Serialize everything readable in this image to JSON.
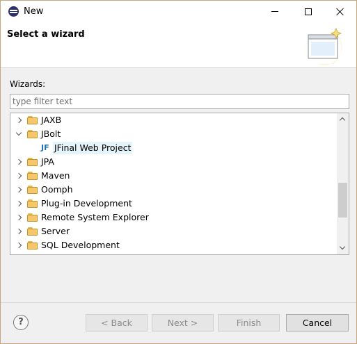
{
  "window": {
    "title": "New"
  },
  "banner": {
    "title": "Select a wizard"
  },
  "wizards": {
    "label": "Wizards:",
    "filter_placeholder": "type filter text",
    "filter_value": "",
    "items": [
      {
        "label": "JAXB",
        "type": "folder",
        "expanded": false
      },
      {
        "label": "JBolt",
        "type": "folder",
        "expanded": true
      },
      {
        "label": "JFinal Web Project",
        "type": "item",
        "icon_text": "JF"
      },
      {
        "label": "JPA",
        "type": "folder",
        "expanded": false
      },
      {
        "label": "Maven",
        "type": "folder",
        "expanded": false
      },
      {
        "label": "Oomph",
        "type": "folder",
        "expanded": false
      },
      {
        "label": "Plug-in Development",
        "type": "folder",
        "expanded": false
      },
      {
        "label": "Remote System Explorer",
        "type": "folder",
        "expanded": false
      },
      {
        "label": "Server",
        "type": "folder",
        "expanded": false
      },
      {
        "label": "SQL Development",
        "type": "folder",
        "expanded": false
      }
    ]
  },
  "buttons": {
    "help": "?",
    "back": "< Back",
    "next": "Next >",
    "finish": "Finish",
    "cancel": "Cancel"
  },
  "colors": {
    "accent_selection": "#e5f3fb",
    "folder": "#f4c76b",
    "jf_icon": "#1f6fb8"
  }
}
